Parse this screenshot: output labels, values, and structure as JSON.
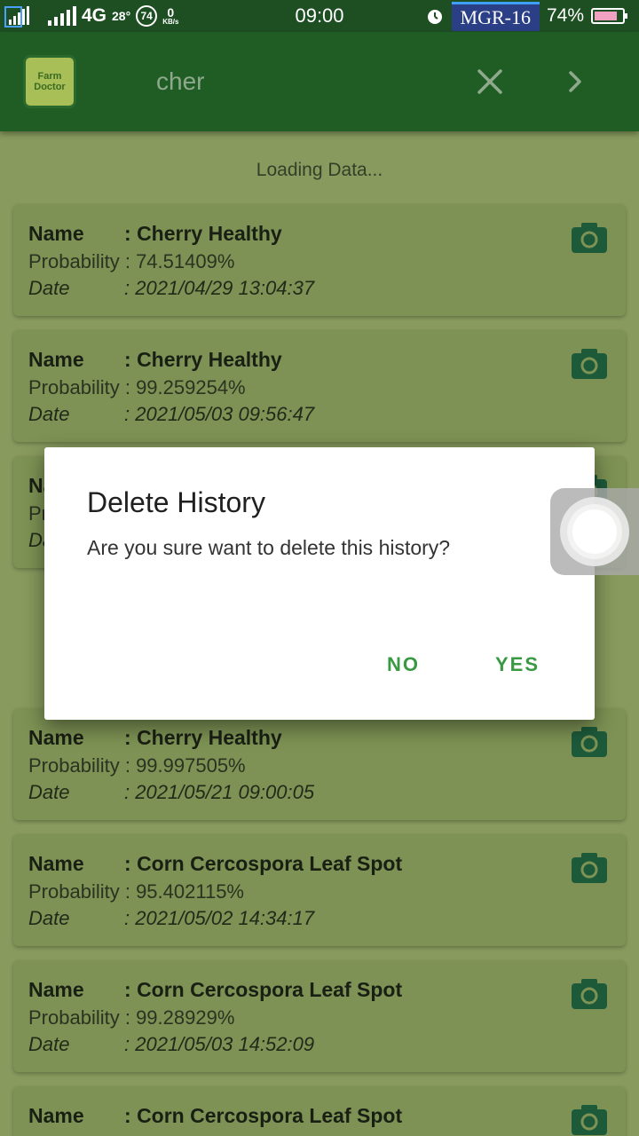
{
  "status_bar": {
    "time": "09:00",
    "network": "4G",
    "temperature": "28°",
    "notif_count": "74",
    "speed_value": "0",
    "speed_unit": "KB/s",
    "carrier": "MGR-16",
    "battery": "74%"
  },
  "app_bar": {
    "logo_line1": "Farm",
    "logo_line2": "Doctor",
    "search_value": "cher"
  },
  "loading_text": "Loading Data...",
  "labels": {
    "name": "Name",
    "probability": "Probability",
    "date": "Date"
  },
  "history": [
    {
      "name": "Cherry Healthy",
      "probability": "74.51409%",
      "date": "2021/04/29 13:04:37"
    },
    {
      "name": "Cherry Healthy",
      "probability": "99.259254%",
      "date": "2021/05/03 09:56:47"
    },
    {
      "name": "",
      "probability": "",
      "date": ""
    },
    {
      "name": "Cherry Healthy",
      "probability": "99.997505%",
      "date": "2021/05/21 09:00:05"
    },
    {
      "name": "Corn Cercospora Leaf Spot",
      "probability": "95.402115%",
      "date": "2021/05/02 14:34:17"
    },
    {
      "name": "Corn Cercospora Leaf Spot",
      "probability": "99.28929%",
      "date": "2021/05/03 14:52:09"
    },
    {
      "name": "Corn Cercospora Leaf Spot",
      "probability": "",
      "date": ""
    }
  ],
  "dialog": {
    "title": "Delete History",
    "message": "Are you sure want to delete this history?",
    "no_label": "NO",
    "yes_label": "YES"
  },
  "colors": {
    "accent": "#3a9a44",
    "app_bar": "#1f5d25",
    "card": "#7d9254",
    "camera_icon": "#1d5a3a"
  },
  "icons": [
    "close-icon",
    "chevron-right-icon",
    "camera-icon"
  ]
}
